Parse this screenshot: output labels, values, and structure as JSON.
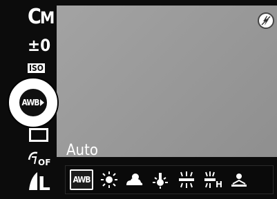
{
  "sidebar": {
    "items": [
      {
        "id": "my-colors",
        "text": "M",
        "prefix": "C"
      },
      {
        "id": "exposure-compensation",
        "text": "±0"
      },
      {
        "id": "iso",
        "text": "ISO"
      },
      {
        "id": "white-balance",
        "text": "AWB"
      },
      {
        "id": "drive-mode",
        "icon": "single-shot-icon"
      },
      {
        "id": "flash-exposure",
        "text": "OFF"
      },
      {
        "id": "image-size",
        "text": "L"
      }
    ],
    "selected_item": "white-balance"
  },
  "status": {
    "flash_icon": "flash-off-icon"
  },
  "white_balance": {
    "current_label": "Auto",
    "options": [
      {
        "name": "awb",
        "label": "AWB",
        "selected": true
      },
      {
        "name": "daylight-icon",
        "selected": false
      },
      {
        "name": "cloudy-icon",
        "selected": false
      },
      {
        "name": "tungsten-icon",
        "selected": false
      },
      {
        "name": "fluorescent-icon",
        "selected": false
      },
      {
        "name": "fluorescent-h-icon",
        "selected": false
      },
      {
        "name": "custom-icon",
        "selected": false
      }
    ]
  },
  "colors": {
    "display_gray": "#999999",
    "frame": "#0c0c0c",
    "text": "#ffffff"
  }
}
